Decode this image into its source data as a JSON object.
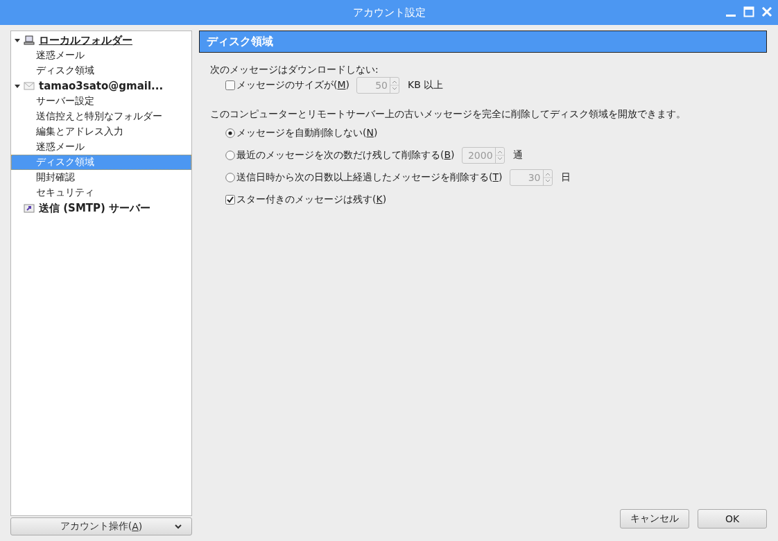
{
  "window": {
    "title": "アカウント設定"
  },
  "tree": [
    {
      "label": "ローカルフォルダー",
      "kind": "computer",
      "expanded": true,
      "selected": false,
      "focused": true,
      "children": [
        {
          "label": "迷惑メール",
          "selected": false
        },
        {
          "label": "ディスク領域",
          "selected": false
        }
      ]
    },
    {
      "label": "tamao3sato@gmail...",
      "kind": "mail",
      "expanded": true,
      "selected": false,
      "focused": false,
      "children": [
        {
          "label": "サーバー設定",
          "selected": false
        },
        {
          "label": "送信控えと特別なフォルダー",
          "selected": false
        },
        {
          "label": "編集とアドレス入力",
          "selected": false
        },
        {
          "label": "迷惑メール",
          "selected": false
        },
        {
          "label": "ディスク領域",
          "selected": true
        },
        {
          "label": "開封確認",
          "selected": false
        },
        {
          "label": "セキュリティ",
          "selected": false
        }
      ]
    },
    {
      "label": "送信 (SMTP) サーバー",
      "kind": "outbox",
      "selected": false,
      "focused": false
    }
  ],
  "account_actions": {
    "before": "アカウント操作(",
    "accesskey": "A",
    "after": ")"
  },
  "panel": {
    "header": "ディスク領域",
    "download_heading": "次のメッセージはダウンロードしない:",
    "size_limit": {
      "checked": false,
      "before": "メッセージのサイズが(",
      "accesskey": "M",
      "after": ")",
      "value": "50",
      "disabled": true,
      "unit": "KB 以上"
    },
    "delete_heading": "このコンピューターとリモートサーバー上の古いメッセージを完全に削除してディスク領域を開放できます。",
    "options": [
      {
        "kind": "radio",
        "selected": true,
        "before": "メッセージを自動削除しない(",
        "accesskey": "N",
        "after": ")"
      },
      {
        "kind": "radio",
        "selected": false,
        "before": "最近のメッセージを次の数だけ残して削除する(",
        "accesskey": "B",
        "after": ")",
        "value": "2000",
        "disabled": true,
        "unit": "通"
      },
      {
        "kind": "radio",
        "selected": false,
        "before": "送信日時から次の日数以上経過したメッセージを削除する(",
        "accesskey": "T",
        "after": ")",
        "value": "30",
        "disabled": true,
        "unit": "日"
      },
      {
        "kind": "checkbox",
        "checked": true,
        "before": "スター付きのメッセージは残す(",
        "accesskey": "K",
        "after": ")"
      }
    ]
  },
  "buttons": [
    {
      "label": "キャンセル"
    },
    {
      "label": "OK"
    }
  ]
}
